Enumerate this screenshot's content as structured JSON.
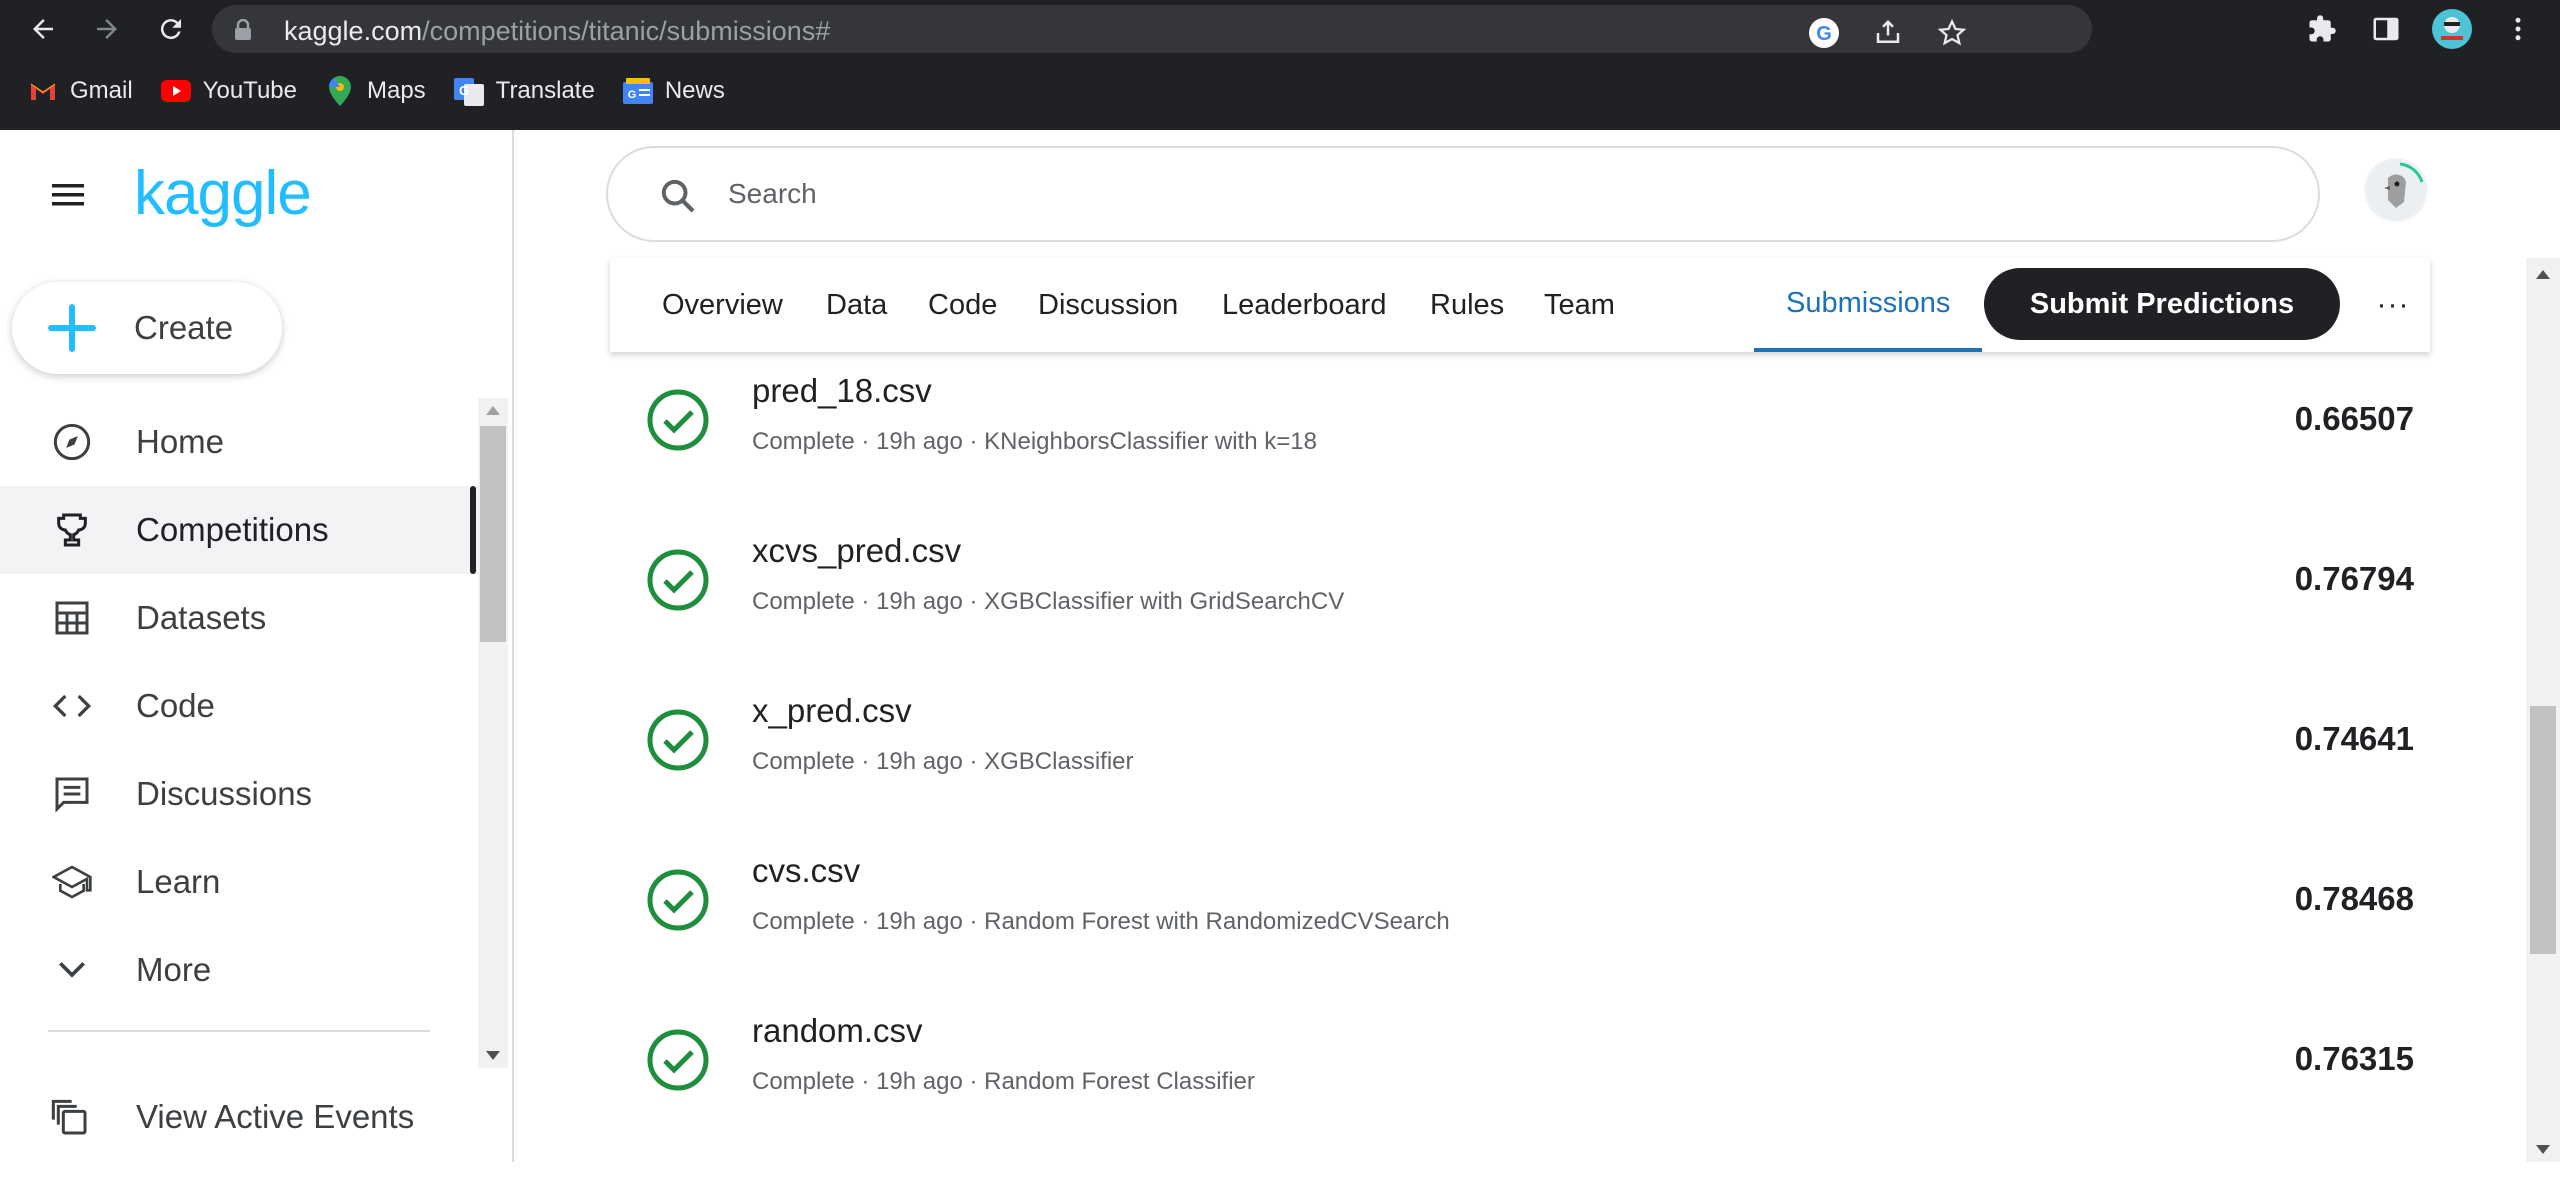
{
  "browser": {
    "url_host": "kaggle.com",
    "url_path": "/competitions/titanic/submissions#",
    "bookmarks": [
      {
        "label": "Gmail",
        "icon": "gmail-icon"
      },
      {
        "label": "YouTube",
        "icon": "youtube-icon"
      },
      {
        "label": "Maps",
        "icon": "maps-icon"
      },
      {
        "label": "Translate",
        "icon": "translate-icon"
      },
      {
        "label": "News",
        "icon": "news-icon"
      }
    ]
  },
  "app": {
    "logo": "kaggle",
    "create_label": "Create",
    "search_placeholder": "Search"
  },
  "sidebar": {
    "items": [
      {
        "label": "Home",
        "icon": "compass-icon",
        "active": false
      },
      {
        "label": "Competitions",
        "icon": "trophy-icon",
        "active": true
      },
      {
        "label": "Datasets",
        "icon": "table-icon",
        "active": false
      },
      {
        "label": "Code",
        "icon": "code-icon",
        "active": false
      },
      {
        "label": "Discussions",
        "icon": "comment-icon",
        "active": false
      },
      {
        "label": "Learn",
        "icon": "school-icon",
        "active": false
      },
      {
        "label": "More",
        "icon": "chevron-down-icon",
        "active": false
      }
    ],
    "view_active_events": "View Active Events"
  },
  "tabs": {
    "items": [
      "Overview",
      "Data",
      "Code",
      "Discussion",
      "Leaderboard",
      "Rules",
      "Team"
    ],
    "active": "Submissions",
    "submit_label": "Submit Predictions",
    "more_label": "···"
  },
  "submissions": [
    {
      "file": "pred_18.csv",
      "meta": "Complete · 19h ago · KNeighborsClassifier with k=18",
      "score": "0.66507"
    },
    {
      "file": "xcvs_pred.csv",
      "meta": "Complete · 19h ago · XGBClassifier with GridSearchCV",
      "score": "0.76794"
    },
    {
      "file": "x_pred.csv",
      "meta": "Complete · 19h ago · XGBClassifier",
      "score": "0.74641"
    },
    {
      "file": "cvs.csv",
      "meta": "Complete · 19h ago · Random Forest with RandomizedCVSearch",
      "score": "0.78468"
    },
    {
      "file": "random.csv",
      "meta": "Complete · 19h ago · Random Forest Classifier",
      "score": "0.76315"
    }
  ],
  "colors": {
    "accent": "#20beff",
    "success": "#1e8e3e",
    "active_tab": "#1a73b8"
  }
}
